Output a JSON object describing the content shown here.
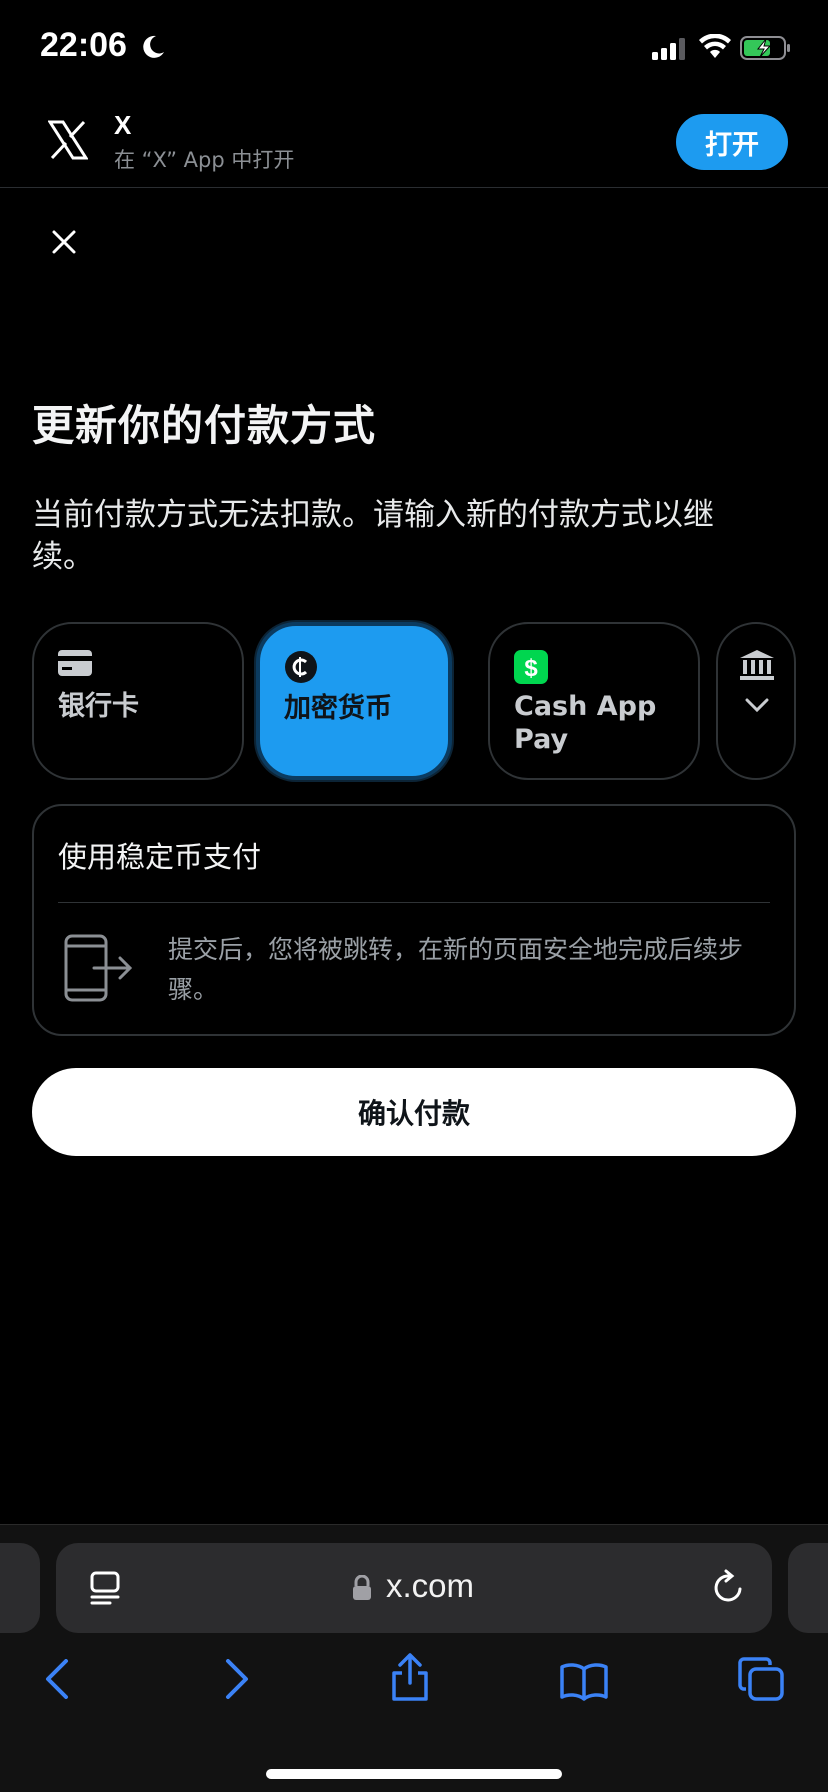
{
  "status_bar": {
    "time": "22:06"
  },
  "banner": {
    "title": "X",
    "subtitle": "在 “X” App 中打开",
    "open_label": "打开"
  },
  "page": {
    "title": "更新你的付款方式",
    "description": "当前付款方式无法扣款。请输入新的付款方式以继续。"
  },
  "methods": [
    {
      "label": "银行卡",
      "icon": "card-icon",
      "selected": false
    },
    {
      "label": "加密货币",
      "icon": "crypto-icon",
      "selected": true
    },
    {
      "label": "Cash App Pay",
      "icon": "cash-app-icon",
      "selected": false
    },
    {
      "label": "",
      "icon": "bank-icon",
      "selected": false
    }
  ],
  "panel": {
    "title": "使用稳定币支付",
    "note": "提交后，您将被跳转，在新的页面安全地完成后续步骤。"
  },
  "confirm_label": "确认付款",
  "browser": {
    "url": "x.com"
  },
  "colors": {
    "accent": "#1d9bf0",
    "background": "#000000",
    "border": "#2f3336",
    "cash_app_green": "#00d64f"
  }
}
